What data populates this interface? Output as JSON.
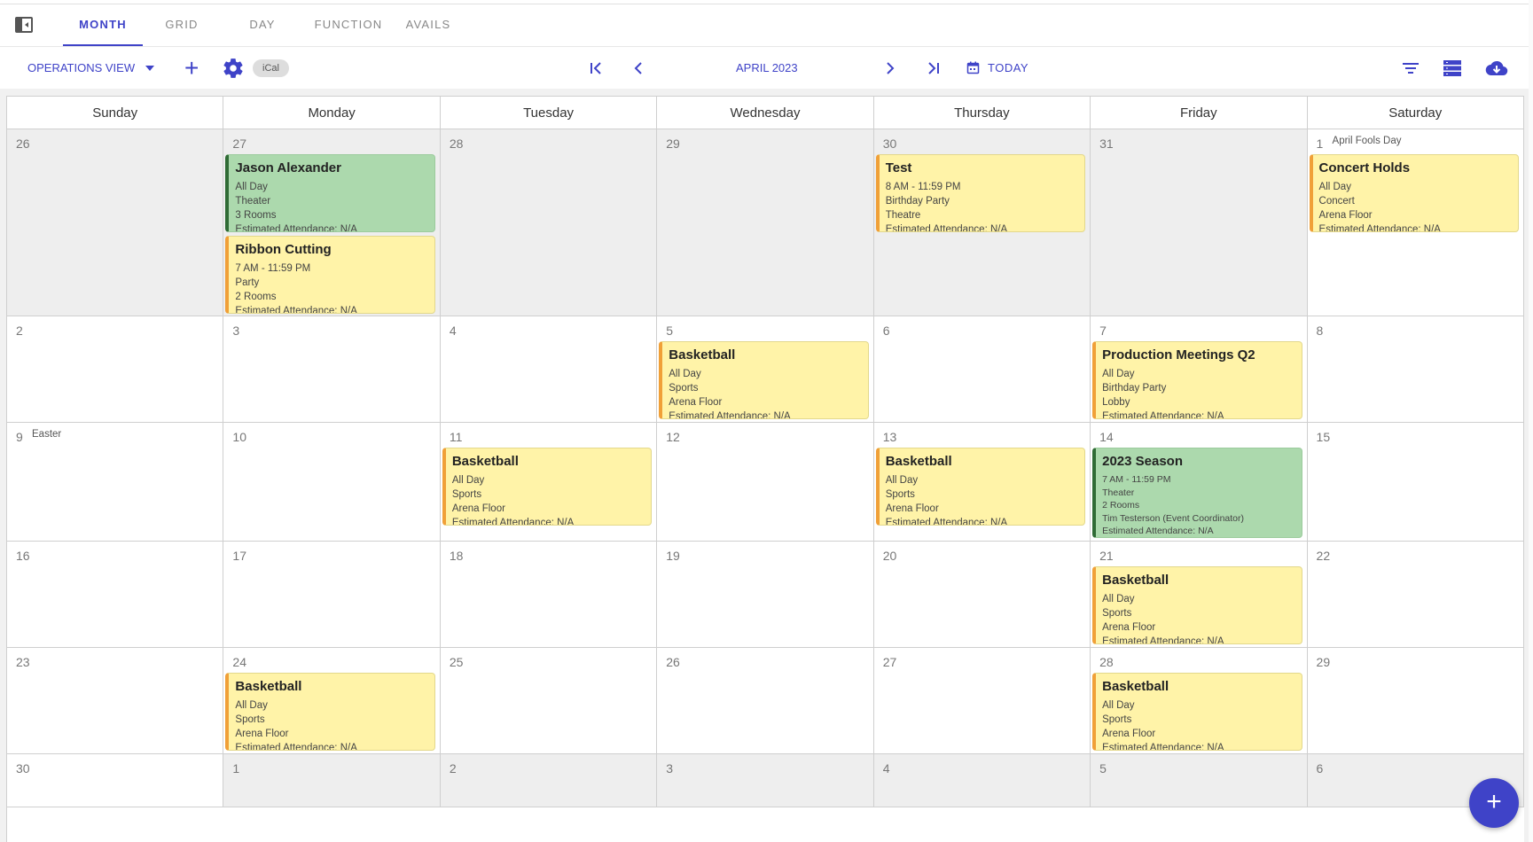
{
  "tabs": [
    {
      "label": "MONTH",
      "active": true
    },
    {
      "label": "GRID",
      "active": false
    },
    {
      "label": "DAY",
      "active": false
    },
    {
      "label": "FUNCTION",
      "active": false
    },
    {
      "label": "AVAILS",
      "active": false
    }
  ],
  "toolbar": {
    "view_label": "OPERATIONS VIEW",
    "ical_label": "iCal",
    "month_label": "APRIL 2023",
    "today_label": "TODAY"
  },
  "colors": {
    "accent": "#3f43c8",
    "event_yellow": "#fff3a8",
    "event_green": "#acd9ad"
  },
  "weekdays": [
    "Sunday",
    "Monday",
    "Tuesday",
    "Wednesday",
    "Thursday",
    "Friday",
    "Saturday"
  ],
  "weeks": [
    {
      "height": 211,
      "days": [
        {
          "num": "26",
          "out": true,
          "events": []
        },
        {
          "num": "27",
          "out": true,
          "events": [
            {
              "title": "Jason Alexander",
              "color": "green",
              "lines": [
                "All Day",
                "Theater",
                "3 Rooms",
                "Estimated Attendance: N/A"
              ]
            },
            {
              "title": "Ribbon Cutting",
              "color": "yellow",
              "lines": [
                "7 AM - 11:59 PM",
                "Party",
                "2 Rooms",
                "Estimated Attendance: N/A"
              ]
            }
          ]
        },
        {
          "num": "28",
          "out": true,
          "events": []
        },
        {
          "num": "29",
          "out": true,
          "events": []
        },
        {
          "num": "30",
          "out": true,
          "events": [
            {
              "title": "Test",
              "color": "yellow",
              "lines": [
                "8 AM - 11:59 PM",
                "Birthday Party",
                "Theatre",
                "Estimated Attendance: N/A"
              ]
            }
          ]
        },
        {
          "num": "31",
          "out": true,
          "events": []
        },
        {
          "num": "1",
          "out": false,
          "holiday": "April Fools Day",
          "events": [
            {
              "title": "Concert Holds",
              "color": "yellow",
              "lines": [
                "All Day",
                "Concert",
                "Arena Floor",
                "Estimated Attendance: N/A"
              ]
            }
          ]
        }
      ]
    },
    {
      "height": 120,
      "days": [
        {
          "num": "2",
          "out": false,
          "events": []
        },
        {
          "num": "3",
          "out": false,
          "events": []
        },
        {
          "num": "4",
          "out": false,
          "events": []
        },
        {
          "num": "5",
          "out": false,
          "events": [
            {
              "title": "Basketball",
              "color": "yellow",
              "lines": [
                "All Day",
                "Sports",
                "Arena Floor",
                "Estimated Attendance: N/A"
              ]
            }
          ]
        },
        {
          "num": "6",
          "out": false,
          "events": []
        },
        {
          "num": "7",
          "out": false,
          "events": [
            {
              "title": "Production Meetings Q2",
              "color": "yellow",
              "lines": [
                "All Day",
                "Birthday Party",
                "Lobby",
                "Estimated Attendance: N/A"
              ]
            }
          ]
        },
        {
          "num": "8",
          "out": false,
          "events": []
        }
      ]
    },
    {
      "height": 134,
      "days": [
        {
          "num": "9",
          "out": false,
          "holiday": "Easter",
          "events": []
        },
        {
          "num": "10",
          "out": false,
          "events": []
        },
        {
          "num": "11",
          "out": false,
          "events": [
            {
              "title": "Basketball",
              "color": "yellow",
              "lines": [
                "All Day",
                "Sports",
                "Arena Floor",
                "Estimated Attendance: N/A"
              ]
            }
          ]
        },
        {
          "num": "12",
          "out": false,
          "events": []
        },
        {
          "num": "13",
          "out": false,
          "events": [
            {
              "title": "Basketball",
              "color": "yellow",
              "lines": [
                "All Day",
                "Sports",
                "Arena Floor",
                "Estimated Attendance: N/A"
              ]
            }
          ]
        },
        {
          "num": "14",
          "out": false,
          "events": [
            {
              "title": "2023 Season",
              "color": "green",
              "lines": [
                "7 AM - 11:59 PM",
                "Theater",
                "2 Rooms",
                "Tim Testerson (Event Coordinator)",
                "Estimated Attendance: N/A"
              ]
            }
          ]
        },
        {
          "num": "15",
          "out": false,
          "events": []
        }
      ]
    },
    {
      "height": 120,
      "days": [
        {
          "num": "16",
          "out": false,
          "events": []
        },
        {
          "num": "17",
          "out": false,
          "events": []
        },
        {
          "num": "18",
          "out": false,
          "events": []
        },
        {
          "num": "19",
          "out": false,
          "events": []
        },
        {
          "num": "20",
          "out": false,
          "events": []
        },
        {
          "num": "21",
          "out": false,
          "events": [
            {
              "title": "Basketball",
              "color": "yellow",
              "lines": [
                "All Day",
                "Sports",
                "Arena Floor",
                "Estimated Attendance: N/A"
              ]
            }
          ]
        },
        {
          "num": "22",
          "out": false,
          "events": []
        }
      ]
    },
    {
      "height": 120,
      "days": [
        {
          "num": "23",
          "out": false,
          "events": []
        },
        {
          "num": "24",
          "out": false,
          "events": [
            {
              "title": "Basketball",
              "color": "yellow",
              "lines": [
                "All Day",
                "Sports",
                "Arena Floor",
                "Estimated Attendance: N/A"
              ]
            }
          ]
        },
        {
          "num": "25",
          "out": false,
          "events": []
        },
        {
          "num": "26",
          "out": false,
          "events": []
        },
        {
          "num": "27",
          "out": false,
          "events": []
        },
        {
          "num": "28",
          "out": false,
          "events": [
            {
              "title": "Basketball",
              "color": "yellow",
              "lines": [
                "All Day",
                "Sports",
                "Arena Floor",
                "Estimated Attendance: N/A"
              ]
            }
          ]
        },
        {
          "num": "29",
          "out": false,
          "events": []
        }
      ]
    },
    {
      "height": 60,
      "days": [
        {
          "num": "30",
          "out": false,
          "events": []
        },
        {
          "num": "1",
          "out": true,
          "events": []
        },
        {
          "num": "2",
          "out": true,
          "events": []
        },
        {
          "num": "3",
          "out": true,
          "events": []
        },
        {
          "num": "4",
          "out": true,
          "events": []
        },
        {
          "num": "5",
          "out": true,
          "events": []
        },
        {
          "num": "6",
          "out": true,
          "events": []
        }
      ]
    }
  ]
}
